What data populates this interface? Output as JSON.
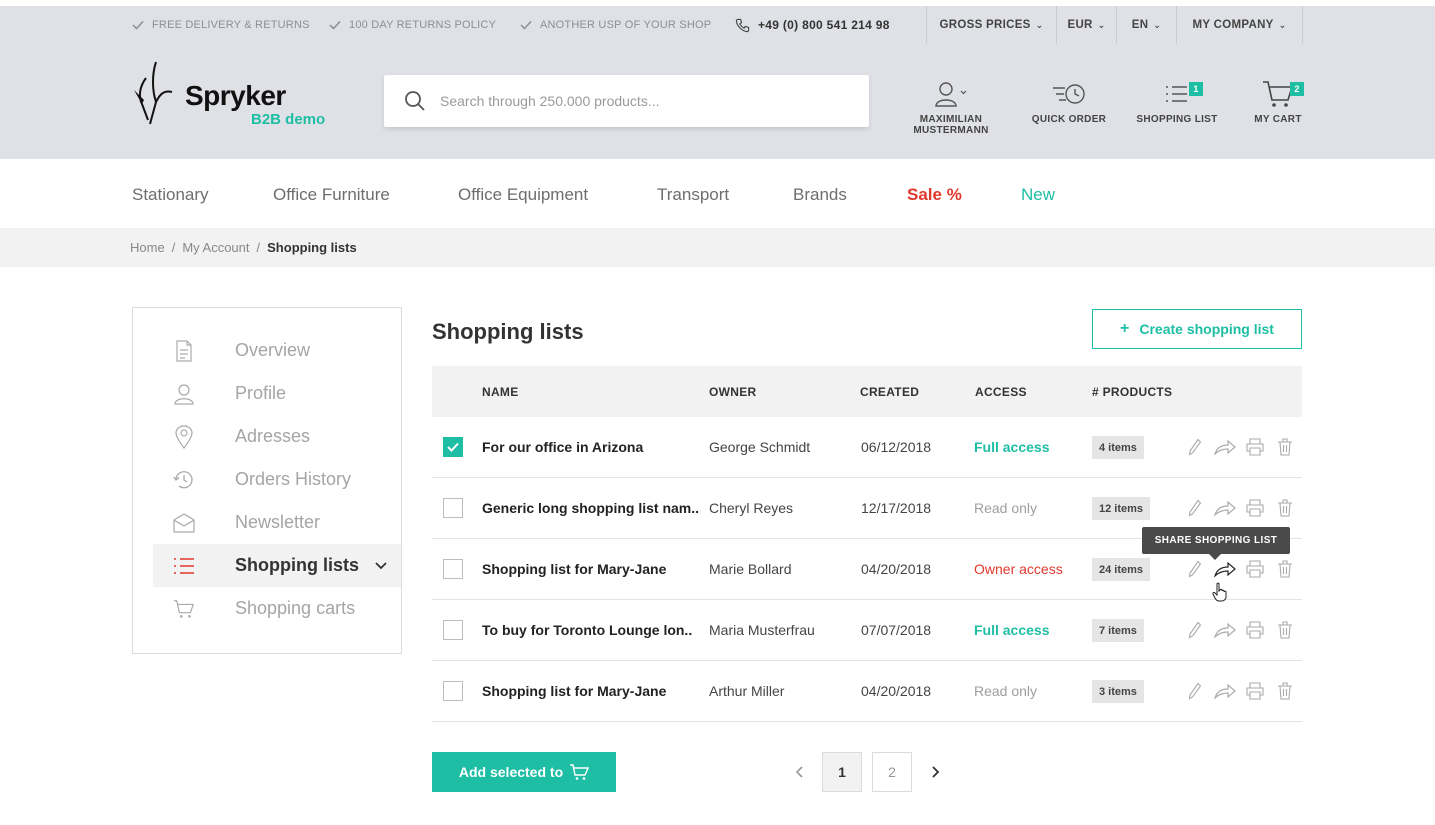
{
  "topbar": {
    "usps": [
      "FREE DELIVERY & RETURNS",
      "100 DAY RETURNS POLICY",
      "ANOTHER USP OF YOUR SHOP"
    ],
    "phone": "+49 (0) 800 541 214 98",
    "price_mode": "GROSS PRICES",
    "currency": "EUR",
    "language": "EN",
    "company": "MY COMPANY"
  },
  "header": {
    "brand": "Spryker",
    "brand_sub": "B2B demo",
    "search_placeholder": "Search through 250.000 products...",
    "user_line1": "MAXIMILIAN",
    "user_line2": "MUSTERMANN",
    "quick_order": "QUICK ORDER",
    "shopping_list": "SHOPPING LIST",
    "shopping_list_count": "1",
    "cart": "MY CART",
    "cart_count": "2"
  },
  "nav": {
    "items": [
      "Stationary",
      "Office Furniture",
      "Office Equipment",
      "Transport",
      "Brands",
      "Sale %",
      "New"
    ]
  },
  "breadcrumb": [
    "Home",
    "My Account",
    "Shopping lists"
  ],
  "sidebar": {
    "items": [
      "Overview",
      "Profile",
      "Adresses",
      "Orders History",
      "Newsletter",
      "Shopping lists",
      "Shopping carts"
    ],
    "active_index": 5
  },
  "main": {
    "title": "Shopping lists",
    "create_label": "Create shopping list",
    "columns": [
      "NAME",
      "OWNER",
      "CREATED",
      "ACCESS",
      "# PRODUCTS"
    ],
    "rows": [
      {
        "checked": true,
        "name": "For our office in Arizona",
        "owner": "George Schmidt",
        "created": "06/12/2018",
        "access": "Full access",
        "products": "4 items"
      },
      {
        "checked": false,
        "name": "Generic long shopping list nam..",
        "owner": "Cheryl Reyes",
        "created": "12/17/2018",
        "access": "Read only",
        "products": "12 items"
      },
      {
        "checked": false,
        "name": "Shopping list for Mary-Jane",
        "owner": "Marie Bollard",
        "created": "04/20/2018",
        "access": "Owner access",
        "products": "24 items"
      },
      {
        "checked": false,
        "name": "To buy for Toronto Lounge lon..",
        "owner": "Maria Musterfrau",
        "created": "07/07/2018",
        "access": "Full access",
        "products": "7 items"
      },
      {
        "checked": false,
        "name": "Shopping list for Mary-Jane",
        "owner": "Arthur Miller",
        "created": "04/20/2018",
        "access": "Read only",
        "products": "3 items"
      }
    ],
    "tooltip": "SHARE SHOPPING LIST",
    "add_selected_label": "Add selected to",
    "pages": [
      "1",
      "2"
    ],
    "current_page": "1"
  },
  "colors": {
    "accent": "#1ebea5",
    "sale": "#e0382b",
    "bar_bg": "#dfe1e6"
  }
}
